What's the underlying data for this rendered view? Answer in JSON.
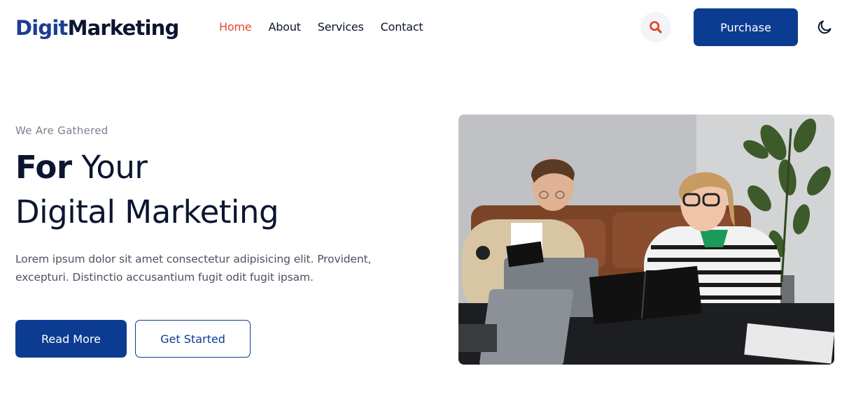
{
  "header": {
    "logo": {
      "part1": "Digit",
      "part2": "Marketing"
    },
    "nav": [
      {
        "label": "Home",
        "active": true
      },
      {
        "label": "About",
        "active": false
      },
      {
        "label": "Services",
        "active": false
      },
      {
        "label": "Contact",
        "active": false
      }
    ],
    "search_icon": "search-icon",
    "purchase_label": "Purchase",
    "theme_icon": "moon-icon"
  },
  "hero": {
    "eyebrow": "We Are Gathered",
    "headline_bold": "For",
    "headline_rest": " Your",
    "headline_line2": "Digital Marketing",
    "description": "Lorem ipsum dolor sit amet consectetur adipisicing elit. Provident, excepturi. Distinctio accusantium fugit odit fugit ipsam.",
    "primary_button": "Read More",
    "secondary_button": "Get Started",
    "image_subject": "two colleagues working at a table with laptops and a notebook"
  },
  "colors": {
    "brand_blue": "#0c3c91",
    "logo_blue": "#1c3e93",
    "accent_red": "#e8442b",
    "text_dark": "#0b1530",
    "text_muted": "#7b7f8e"
  }
}
